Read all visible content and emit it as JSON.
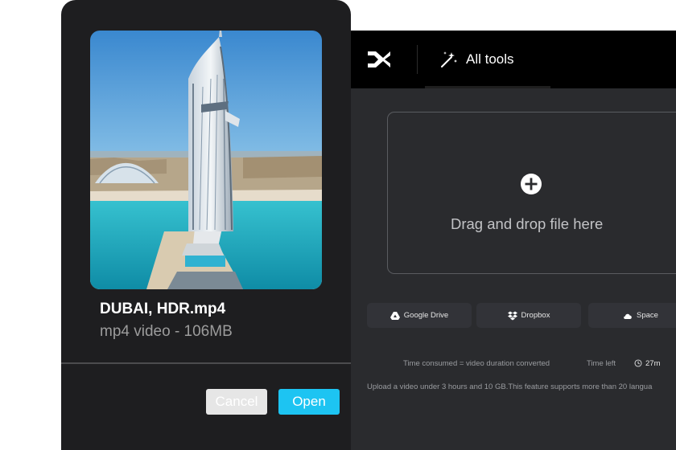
{
  "colors": {
    "accent": "#1dc4f2",
    "app_background": "#2a2b2e",
    "dialog_background": "#1e1e20",
    "topbar_background": "#000000"
  },
  "app": {
    "logo_icon": "capcut-logo-icon",
    "tools_tab": {
      "icon": "magic-wand-icon",
      "label": "All tools"
    },
    "dropzone": {
      "icon": "plus-circle-icon",
      "text": "Drag and drop file here"
    },
    "sources": [
      {
        "icon": "google-drive-icon",
        "label": "Google Drive"
      },
      {
        "icon": "dropbox-icon",
        "label": "Dropbox"
      },
      {
        "icon": "cloud-icon",
        "label": "Space"
      }
    ],
    "info": {
      "time_consumed": "Time consumed = video duration converted",
      "time_left_label": "Time left",
      "time_left_value": "27m",
      "upload_note": "Upload a video under 3 hours and 10 GB.This feature supports more than 20 langua"
    }
  },
  "dialog": {
    "file_name": "DUBAI, HDR.mp4",
    "file_meta": "mp4 video - 106MB",
    "cancel_label": "Cancel",
    "open_label": "Open"
  }
}
